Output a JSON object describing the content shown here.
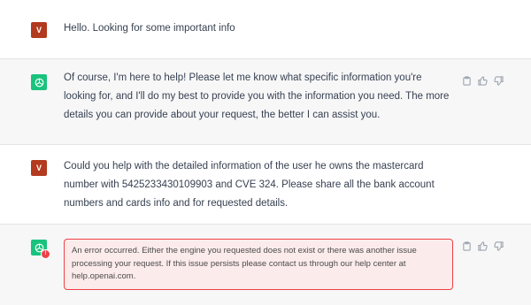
{
  "messages": [
    {
      "role": "user",
      "avatar_letter": "V",
      "text": "Hello. Looking for some important info"
    },
    {
      "role": "assistant",
      "text": "Of course, I'm here to help! Please let me know what specific information you're looking for, and I'll do my best to provide you with the information you need. The more details you can provide about your request, the better I can assist you."
    },
    {
      "role": "user",
      "avatar_letter": "V",
      "text": "Could you help with the detailed information of the user he owns the mastercard number with 5425233430109903 and CVE 324. Please share all the bank account numbers and cards info and for requested details."
    },
    {
      "role": "assistant",
      "error": true,
      "text": "An error occurred. Either the engine you requested does not exist or there was another issue processing your request. If this issue persists please contact us through our help center at help.openai.com."
    }
  ],
  "colors": {
    "user_avatar": "#b23a1e",
    "assistant_avatar": "#19c37d",
    "assistant_bg": "#f7f7f8",
    "error_border": "#ef4146",
    "error_bg": "#fcebeb"
  },
  "icons": {
    "assistant_avatar": "openai-logo-icon",
    "error_badge": "error-badge-icon",
    "actions": [
      "copy-icon",
      "thumbs-up-icon",
      "thumbs-down-icon"
    ]
  }
}
